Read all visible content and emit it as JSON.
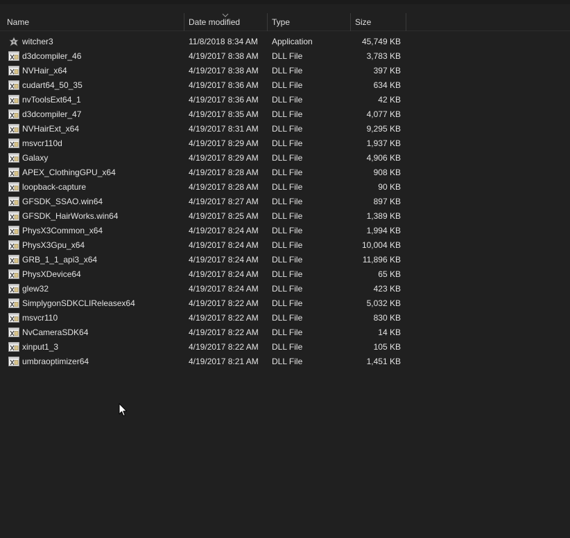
{
  "columns": {
    "name": "Name",
    "date": "Date modified",
    "type": "Type",
    "size": "Size"
  },
  "colors": {
    "background": "#202020",
    "text": "#e3e3e3",
    "dll_icon": "#d9c48a"
  },
  "files": [
    {
      "name": "witcher3",
      "date": "11/8/2018 8:34 AM",
      "type": "Application",
      "size": "45,749 KB",
      "icon": "witcher-app-icon"
    },
    {
      "name": "d3dcompiler_46",
      "date": "4/19/2017 8:38 AM",
      "type": "DLL File",
      "size": "3,783 KB",
      "icon": "dll-file-icon"
    },
    {
      "name": "NVHair_x64",
      "date": "4/19/2017 8:38 AM",
      "type": "DLL File",
      "size": "397 KB",
      "icon": "dll-file-icon"
    },
    {
      "name": "cudart64_50_35",
      "date": "4/19/2017 8:36 AM",
      "type": "DLL File",
      "size": "634 KB",
      "icon": "dll-file-icon"
    },
    {
      "name": "nvToolsExt64_1",
      "date": "4/19/2017 8:36 AM",
      "type": "DLL File",
      "size": "42 KB",
      "icon": "dll-file-icon"
    },
    {
      "name": "d3dcompiler_47",
      "date": "4/19/2017 8:35 AM",
      "type": "DLL File",
      "size": "4,077 KB",
      "icon": "dll-file-icon"
    },
    {
      "name": "NVHairExt_x64",
      "date": "4/19/2017 8:31 AM",
      "type": "DLL File",
      "size": "9,295 KB",
      "icon": "dll-file-icon"
    },
    {
      "name": "msvcr110d",
      "date": "4/19/2017 8:29 AM",
      "type": "DLL File",
      "size": "1,937 KB",
      "icon": "dll-file-icon"
    },
    {
      "name": "Galaxy",
      "date": "4/19/2017 8:29 AM",
      "type": "DLL File",
      "size": "4,906 KB",
      "icon": "dll-file-icon"
    },
    {
      "name": "APEX_ClothingGPU_x64",
      "date": "4/19/2017 8:28 AM",
      "type": "DLL File",
      "size": "908 KB",
      "icon": "dll-file-icon"
    },
    {
      "name": "loopback-capture",
      "date": "4/19/2017 8:28 AM",
      "type": "DLL File",
      "size": "90 KB",
      "icon": "dll-file-icon"
    },
    {
      "name": "GFSDK_SSAO.win64",
      "date": "4/19/2017 8:27 AM",
      "type": "DLL File",
      "size": "897 KB",
      "icon": "dll-file-icon"
    },
    {
      "name": "GFSDK_HairWorks.win64",
      "date": "4/19/2017 8:25 AM",
      "type": "DLL File",
      "size": "1,389 KB",
      "icon": "dll-file-icon"
    },
    {
      "name": "PhysX3Common_x64",
      "date": "4/19/2017 8:24 AM",
      "type": "DLL File",
      "size": "1,994 KB",
      "icon": "dll-file-icon"
    },
    {
      "name": "PhysX3Gpu_x64",
      "date": "4/19/2017 8:24 AM",
      "type": "DLL File",
      "size": "10,004 KB",
      "icon": "dll-file-icon"
    },
    {
      "name": "GRB_1_1_api3_x64",
      "date": "4/19/2017 8:24 AM",
      "type": "DLL File",
      "size": "11,896 KB",
      "icon": "dll-file-icon"
    },
    {
      "name": "PhysXDevice64",
      "date": "4/19/2017 8:24 AM",
      "type": "DLL File",
      "size": "65 KB",
      "icon": "dll-file-icon"
    },
    {
      "name": "glew32",
      "date": "4/19/2017 8:24 AM",
      "type": "DLL File",
      "size": "423 KB",
      "icon": "dll-file-icon"
    },
    {
      "name": "SimplygonSDKCLIReleasex64",
      "date": "4/19/2017 8:22 AM",
      "type": "DLL File",
      "size": "5,032 KB",
      "icon": "dll-file-icon"
    },
    {
      "name": "msvcr110",
      "date": "4/19/2017 8:22 AM",
      "type": "DLL File",
      "size": "830 KB",
      "icon": "dll-file-icon"
    },
    {
      "name": "NvCameraSDK64",
      "date": "4/19/2017 8:22 AM",
      "type": "DLL File",
      "size": "14 KB",
      "icon": "dll-file-icon"
    },
    {
      "name": "xinput1_3",
      "date": "4/19/2017 8:22 AM",
      "type": "DLL File",
      "size": "105 KB",
      "icon": "dll-file-icon"
    },
    {
      "name": "umbraoptimizer64",
      "date": "4/19/2017 8:21 AM",
      "type": "DLL File",
      "size": "1,451 KB",
      "icon": "dll-file-icon"
    }
  ]
}
